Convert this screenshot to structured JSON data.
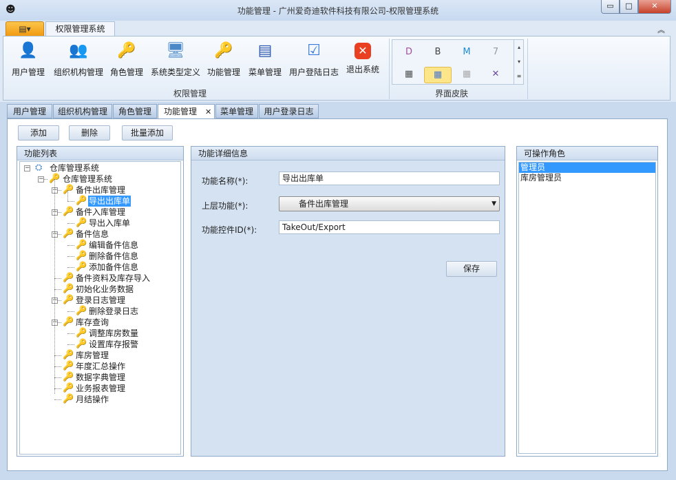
{
  "window": {
    "title": "功能管理 - 广州爱奇迪软件科技有限公司-权限管理系统",
    "min": "▭",
    "max": "□",
    "close": "✕"
  },
  "ribbon": {
    "app_menu": "▤▾",
    "tab": "权限管理系统",
    "collapse": "︽",
    "buttons": [
      {
        "label": "用户管理",
        "icon": "user-icon"
      },
      {
        "label": "组织机构管理",
        "icon": "organization-icon"
      },
      {
        "label": "角色管理",
        "icon": "role-key-icon"
      },
      {
        "label": "系统类型定义",
        "icon": "computer-icon"
      },
      {
        "label": "功能管理",
        "icon": "key-icon"
      },
      {
        "label": "菜单管理",
        "icon": "menu-icon"
      },
      {
        "label": "用户登陆日志",
        "icon": "checklist-icon"
      },
      {
        "label": "退出系统",
        "icon": "exit-icon"
      }
    ],
    "group_label": "权限管理",
    "skin_group_label": "界面皮肤",
    "skins": [
      "D",
      "B",
      "M",
      "7",
      "▦",
      "▦",
      "▦",
      "✕"
    ]
  },
  "doc_tabs": [
    {
      "label": "用户管理"
    },
    {
      "label": "组织机构管理"
    },
    {
      "label": "角色管理"
    },
    {
      "label": "功能管理",
      "active": true,
      "close": "✕"
    },
    {
      "label": "菜单管理"
    },
    {
      "label": "用户登录日志"
    }
  ],
  "toolbar": {
    "add": "添加",
    "delete": "删除",
    "batch_add": "批量添加"
  },
  "tree": {
    "title": "功能列表",
    "items": [
      {
        "label": "仓库管理系统",
        "level": 0,
        "expanded": true
      },
      {
        "label": "仓库管理系统",
        "level": 1,
        "expanded": true
      },
      {
        "label": "备件出库管理",
        "level": 2,
        "expanded": true
      },
      {
        "label": "导出出库单",
        "level": 3,
        "selected": true
      },
      {
        "label": "备件入库管理",
        "level": 2,
        "expanded": true
      },
      {
        "label": "导出入库单",
        "level": 3
      },
      {
        "label": "备件信息",
        "level": 2,
        "expanded": true
      },
      {
        "label": "编辑备件信息",
        "level": 3
      },
      {
        "label": "删除备件信息",
        "level": 3
      },
      {
        "label": "添加备件信息",
        "level": 3
      },
      {
        "label": "备件资料及库存导入",
        "level": 2
      },
      {
        "label": "初始化业务数据",
        "level": 2
      },
      {
        "label": "登录日志管理",
        "level": 2,
        "expanded": true
      },
      {
        "label": "删除登录日志",
        "level": 3
      },
      {
        "label": "库存查询",
        "level": 2,
        "expanded": true
      },
      {
        "label": "调整库房数量",
        "level": 3
      },
      {
        "label": "设置库存报警",
        "level": 3
      },
      {
        "label": "库房管理",
        "level": 2
      },
      {
        "label": "年度汇总操作",
        "level": 2
      },
      {
        "label": "数据字典管理",
        "level": 2
      },
      {
        "label": "业务报表管理",
        "level": 2
      },
      {
        "label": "月结操作",
        "level": 2
      }
    ]
  },
  "detail": {
    "title": "功能详细信息",
    "name_label": "功能名称(*):",
    "name_value": "导出出库单",
    "parent_label": "上层功能(*):",
    "parent_value": "备件出库管理",
    "id_label": "功能控件ID(*):",
    "id_value": "TakeOut/Export",
    "save": "保存"
  },
  "roles": {
    "title": "可操作角色",
    "items": [
      {
        "label": "管理员",
        "selected": true
      },
      {
        "label": "库房管理员"
      }
    ]
  },
  "colors": {
    "selection": "#3399ff",
    "app_button": "#f5a623",
    "panel_bg": "#d5e2f2"
  }
}
